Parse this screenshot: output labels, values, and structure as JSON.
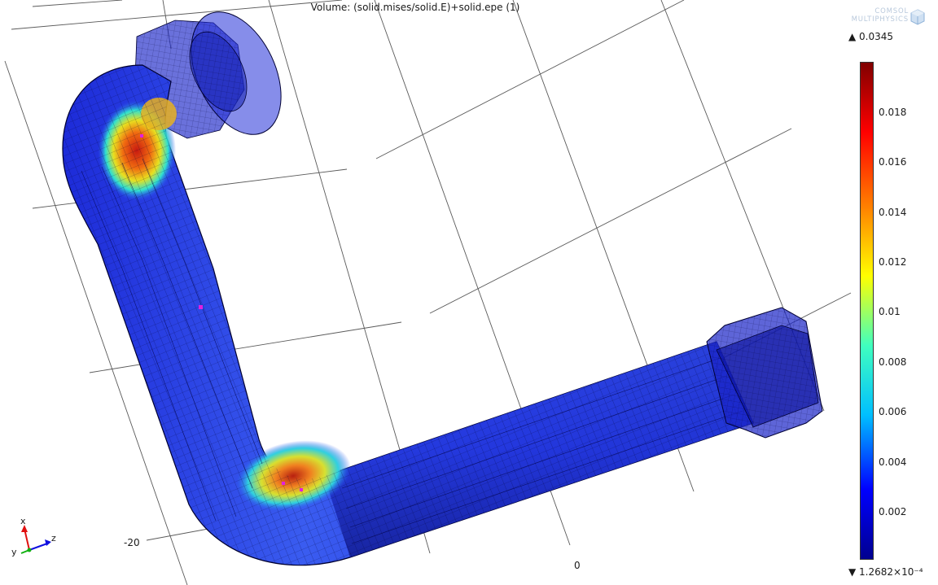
{
  "title": "Volume: (solid.mises/solid.E)+solid.epe (1)",
  "logo": {
    "line1": "COMSOL",
    "line2": "MULTIPHYSICS"
  },
  "colorbar": {
    "max_label": "▲ 0.0345",
    "min_label": "▼ 1.2682×10⁻⁴",
    "ticks": [
      "0.018",
      "0.016",
      "0.014",
      "0.012",
      "0.01",
      "0.008",
      "0.006",
      "0.004",
      "0.002"
    ],
    "colors": [
      "#00008f",
      "#0000ff",
      "#00bfff",
      "#40ffbf",
      "#ffff00",
      "#ff8000",
      "#ff0000",
      "#800000"
    ]
  },
  "axes": {
    "label_neg20": "-20",
    "label_0": "0"
  },
  "triad": {
    "x": "x",
    "y": "y",
    "z": "z"
  }
}
